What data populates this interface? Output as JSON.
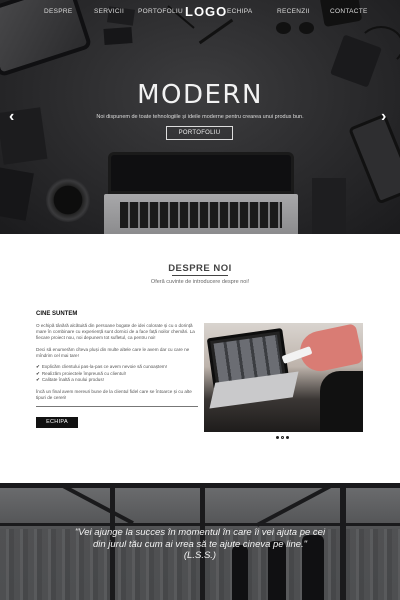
{
  "nav": {
    "items": [
      "DESPRE",
      "SERVICII",
      "PORTOFOLIU",
      "ECHIPA",
      "RECENZII",
      "CONTACTE"
    ],
    "logo": "LOGO"
  },
  "hero": {
    "title": "MODERN",
    "subtitle": "Noi dispunem de toate tehnologiile și ideile moderne pentru crearea unui produs bun.",
    "button": "PORTOFOLIU",
    "prev_arrow": "‹",
    "next_arrow": "›"
  },
  "about": {
    "title": "DESPRE NOI",
    "subtitle": "Oferă cuvinte de introducere despre noi!",
    "heading": "CINE SUNTEM",
    "paragraph1": "O echipă tânără alcătuită din persoane bogate de idei colorate și cu o dorință mare în combinare cu experiență sunt dornici de a face față noilor chemări. La fiecare proiect nou, noi depunem tot sufletul, ca pentru noi!",
    "paragraph2": "Deci să enumerăm cîteva pluși din multe altele care le avem dar cu care ne mîndrim cel mai tare!",
    "bullets": [
      "Explicăm clientului pas-la-pas ce avem nevoie să cunoaștem!",
      "Realizăm proiectele împreună cu clientul!",
      "Calitate înaltă a noului produs!"
    ],
    "paragraph3": "Încă un final avem mereuri bune de la clientul fidel care se întoarce și cu alte tipuri de cereri!",
    "button": "ECHIPA",
    "slider_dots": 3
  },
  "quote": {
    "line1": "\"Vei ajunge la succes în momentul în care îi vei ajuta pe cei",
    "line2": "din jurul tău cum ai vrea să te ajute cineva pe line.\"",
    "author": "(L.S.S.)"
  },
  "colors": {
    "hero_bg": "#2a2a2c",
    "accent": "#111111",
    "text": "#555555"
  }
}
